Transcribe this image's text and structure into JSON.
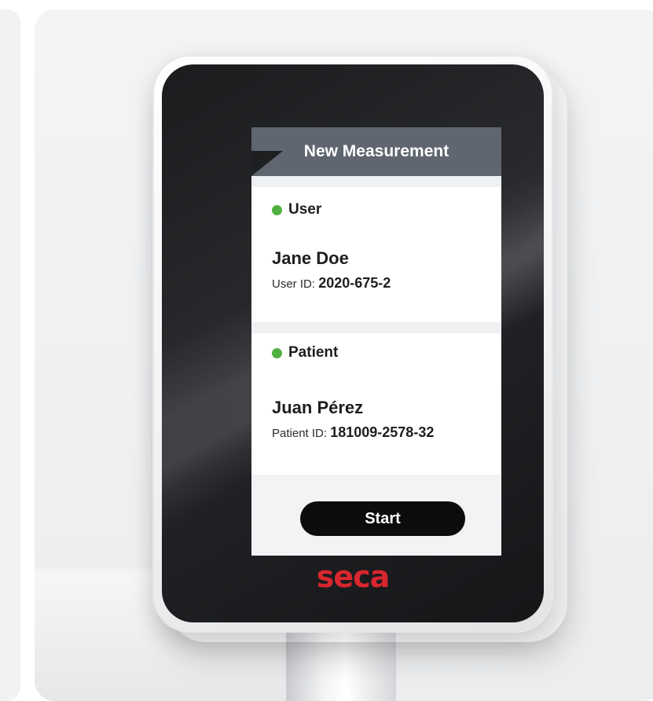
{
  "screen": {
    "header_title": "New Measurement",
    "user_section": {
      "title": "User",
      "status_color": "#52b040",
      "name": "Jane Doe",
      "id_label": "User ID:",
      "id_value": "2020-675-2"
    },
    "patient_section": {
      "title": "Patient",
      "status_color": "#52b040",
      "name": "Juan Pérez",
      "id_label": "Patient ID:",
      "id_value": "181009-2578-32"
    },
    "start_button_label": "Start"
  },
  "device": {
    "brand": "seca",
    "brand_color": "#d8262e"
  }
}
